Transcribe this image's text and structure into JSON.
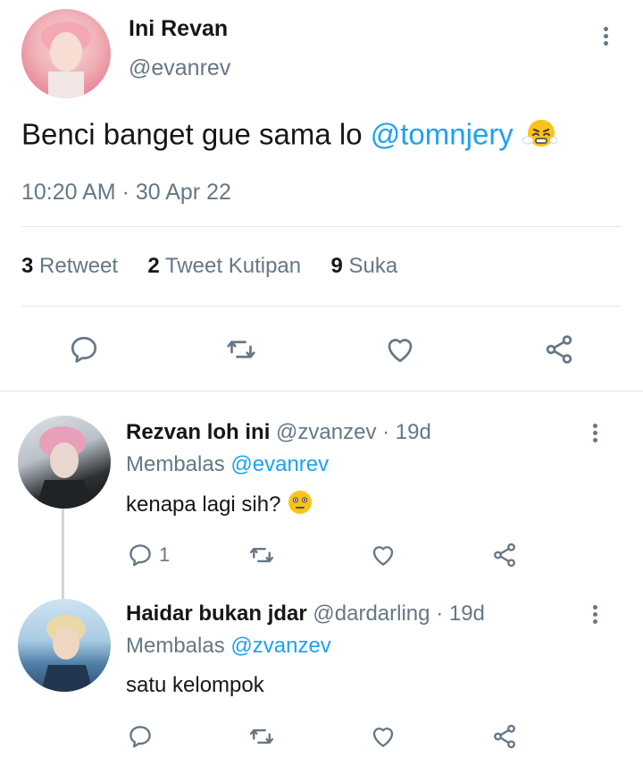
{
  "tweet": {
    "display_name": "Ini Revan",
    "handle": "@evanrev",
    "text": "Benci banget gue sama lo ",
    "mention": "@tomnjery",
    "emoji_icon": "steam-from-nose-emoji-icon",
    "timestamp": "10:20 AM · 30 Apr 22",
    "stats": {
      "retweet_count": "3",
      "retweet_label": "Retweet",
      "quote_count": "2",
      "quote_label": "Tweet Kutipan",
      "like_count": "9",
      "like_label": "Suka"
    },
    "actions": [
      "reply-icon",
      "retweet-icon",
      "like-icon",
      "share-icon"
    ]
  },
  "replies": [
    {
      "display_name": "Rezvan loh ini",
      "handle": "@zvanzev",
      "age": "· 19d",
      "replying_prefix": "Membalas",
      "replying_to": "@evanrev",
      "text": "kenapa lagi sih? ",
      "emoji_icon": "flushed-face-emoji-icon",
      "reply_count": "1"
    },
    {
      "display_name": "Haidar bukan jdar",
      "handle": "@dardarling",
      "age": "· 19d",
      "replying_prefix": "Membalas",
      "replying_to": "@zvanzev",
      "text": "satu kelompok",
      "emoji_icon": "",
      "reply_count": ""
    }
  ],
  "colors": {
    "link": "#1da1f2",
    "muted": "#657786",
    "text": "#14171a",
    "divider": "#e1e8ed"
  }
}
